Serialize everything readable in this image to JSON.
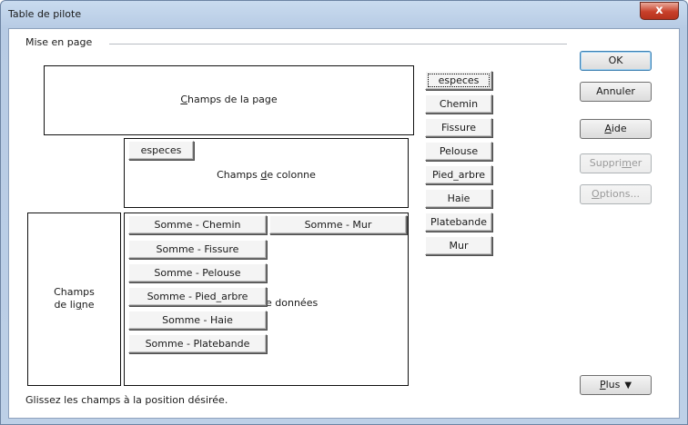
{
  "window": {
    "title": "Table de pilote",
    "close_glyph": "x"
  },
  "layout": {
    "group_label": "Mise en page",
    "page_area_label": "Champs de la page",
    "column_area_label": "Champs de colonne",
    "row_area_label_line1": "Champs",
    "row_area_label_line2": "de ligne",
    "data_area_label": "e données",
    "status_text": "Glissez les champs à la position désirée."
  },
  "column_fields": [
    "especes"
  ],
  "data_fields": [
    "Somme - Chemin",
    "Somme - Mur",
    "Somme - Fissure",
    "Somme - Pelouse",
    "Somme - Pied_arbre",
    "Somme - Haie",
    "Somme - Platebande"
  ],
  "available_fields": [
    "especes",
    "Chemin",
    "Fissure",
    "Pelouse",
    "Pied_arbre",
    "Haie",
    "Platebande",
    "Mur"
  ],
  "buttons": {
    "ok": "OK",
    "cancel": "Annuler",
    "help": "Aide",
    "delete": "Supprimer",
    "options": "Options...",
    "more": "Plus"
  },
  "icons": {
    "more": "double-chevron-down-icon"
  },
  "colors": {
    "title_bar": "#bdd0e7",
    "close_button": "#c8402a",
    "disabled_text": "#9a9a9a"
  }
}
